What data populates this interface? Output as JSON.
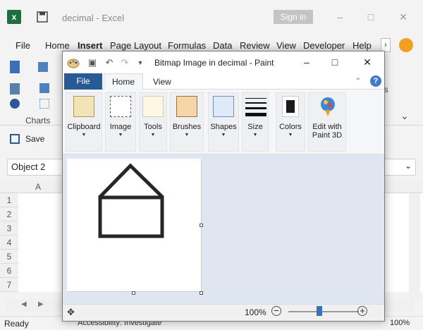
{
  "excel": {
    "title": "decimal  -  Excel",
    "signin_label": "Sign in",
    "logo_letter": "x",
    "menu": [
      "File",
      "Home",
      "Insert",
      "Page Layout",
      "Formulas",
      "Data",
      "Review",
      "View",
      "Developer",
      "Help"
    ],
    "charts_label": "Charts",
    "save_label": "Save",
    "namebox_value": "Object 2",
    "column_label": "A",
    "rows": [
      "1",
      "2",
      "3",
      "4",
      "5",
      "6",
      "7"
    ],
    "status_ready": "Ready",
    "status_accessibility": "Accessibility: Investigate",
    "status_zoom": "100%"
  },
  "paint": {
    "title": "Bitmap Image in decimal - Paint",
    "tabs": {
      "file": "File",
      "home": "Home",
      "view": "View"
    },
    "groups": [
      {
        "label": "Clipboard",
        "icon": "clipboard-icon"
      },
      {
        "label": "Image",
        "icon": "select-icon"
      },
      {
        "label": "Tools",
        "icon": "pencil-icon"
      },
      {
        "label": "Brushes",
        "icon": "brush-icon"
      },
      {
        "label": "Shapes",
        "icon": "shapes-icon"
      },
      {
        "label": "Size",
        "icon": "line-size-icon"
      },
      {
        "label": "Colors",
        "icon": "color-swatch-icon"
      },
      {
        "label": "Edit with",
        "label2": "Paint 3D",
        "icon": "paint3d-icon"
      }
    ],
    "zoom": "100%",
    "help_glyph": "?"
  }
}
